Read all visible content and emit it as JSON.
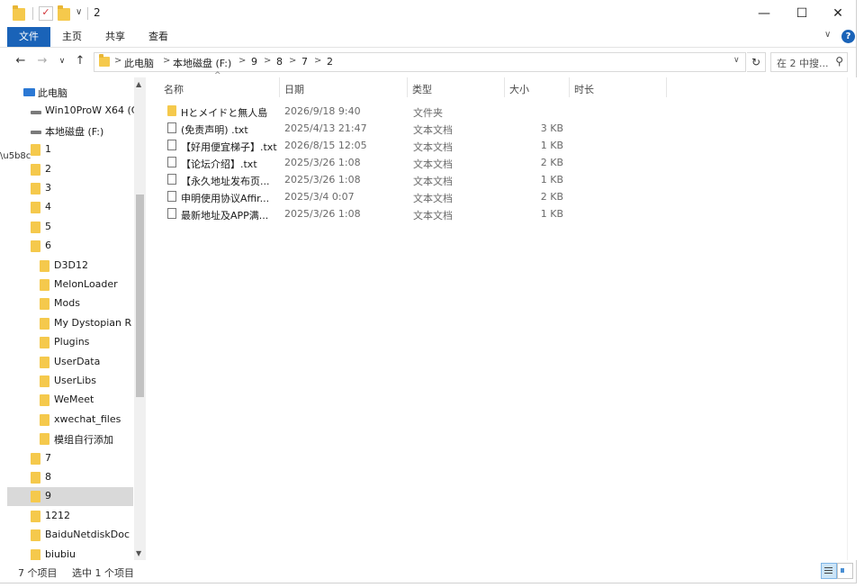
{
  "window": {
    "title": "2",
    "qat_caret": "∨",
    "controls": {
      "minimize": "—",
      "maximize": "☐",
      "close": "✕"
    }
  },
  "ribbon": {
    "tabs": [
      "文件",
      "主页",
      "共享",
      "查看"
    ],
    "help": "?",
    "collapse": "∨"
  },
  "nav": {
    "back": "←",
    "forward": "→",
    "recent": "∨",
    "up": "↑",
    "breadcrumb": [
      "此电脑",
      "本地磁盘 (F:)",
      "9",
      "8",
      "7",
      "2"
    ],
    "crumb_separator": ">",
    "refresh": "↻",
    "search_placeholder": "在 2 中搜...",
    "search_icon": "search-icon"
  },
  "tree": {
    "items": [
      {
        "label": "此电脑",
        "kind": "pc",
        "indent": 0
      },
      {
        "label": "Win10ProW X64 (C",
        "kind": "drive",
        "indent": 1
      },
      {
        "label": "本地磁盘 (F:)",
        "kind": "drive",
        "indent": 1
      },
      {
        "label": "1",
        "kind": "folder",
        "indent": 2
      },
      {
        "label": "2",
        "kind": "folder",
        "indent": 2
      },
      {
        "label": "3",
        "kind": "folder",
        "indent": 2
      },
      {
        "label": "4",
        "kind": "folder",
        "indent": 2
      },
      {
        "label": "5",
        "kind": "folder",
        "indent": 2
      },
      {
        "label": "6",
        "kind": "folder",
        "indent": 2
      },
      {
        "label": "D3D12",
        "kind": "folder",
        "indent": 3
      },
      {
        "label": "MelonLoader",
        "kind": "folder",
        "indent": 3
      },
      {
        "label": "Mods",
        "kind": "folder",
        "indent": 3
      },
      {
        "label": "My Dystopian R",
        "kind": "folder",
        "indent": 3
      },
      {
        "label": "Plugins",
        "kind": "folder",
        "indent": 3
      },
      {
        "label": "UserData",
        "kind": "folder",
        "indent": 3
      },
      {
        "label": "UserLibs",
        "kind": "folder",
        "indent": 3
      },
      {
        "label": "WeMeet",
        "kind": "folder",
        "indent": 3
      },
      {
        "label": "xwechat_files",
        "kind": "folder",
        "indent": 3
      },
      {
        "label": "模组自行添加",
        "kind": "folder",
        "indent": 3
      },
      {
        "label": "7",
        "kind": "folder",
        "indent": 2
      },
      {
        "label": "8",
        "kind": "folder",
        "indent": 2
      },
      {
        "label": "9",
        "kind": "folder",
        "indent": 2,
        "selected": true
      },
      {
        "label": "1212",
        "kind": "folder",
        "indent": 2
      },
      {
        "label": "BaiduNetdiskDoc",
        "kind": "folder",
        "indent": 2
      },
      {
        "label": "biubiu",
        "kind": "folder",
        "indent": 2
      }
    ]
  },
  "columns": {
    "name": "名称",
    "date": "日期",
    "type": "类型",
    "size": "大小",
    "length": "时长",
    "sort_indicator": "^"
  },
  "files": [
    {
      "name": "Hとメイドと無人島",
      "date": "2026/9/18 9:40",
      "type": "文件夹",
      "size": "",
      "is_folder": true
    },
    {
      "name": "(免责声明) .txt",
      "date": "2025/4/13 21:47",
      "type": "文本文档",
      "size": "3 KB"
    },
    {
      "name": "【好用便宜梯子】.txt",
      "date": "2026/8/15 12:05",
      "type": "文本文档",
      "size": "1 KB"
    },
    {
      "name": "【论坛介绍】.txt",
      "date": "2025/3/26 1:08",
      "type": "文本文档",
      "size": "2 KB"
    },
    {
      "name": "【永久地址发布页...",
      "date": "2025/3/26 1:08",
      "type": "文本文档",
      "size": "1 KB"
    },
    {
      "name": "申明使用协议Affir...",
      "date": "2025/3/4 0:07",
      "type": "文本文档",
      "size": "2 KB"
    },
    {
      "name": "最新地址及APP满...",
      "date": "2025/3/26 1:08",
      "type": "文本文档",
      "size": "1 KB"
    }
  ],
  "status": {
    "count": "7 个项目",
    "selected": "选中 1 个项目"
  },
  "colors": {
    "accent": "#1a63b8",
    "folder": "#f5c94c",
    "selected_tree": "#d9d9d9"
  }
}
